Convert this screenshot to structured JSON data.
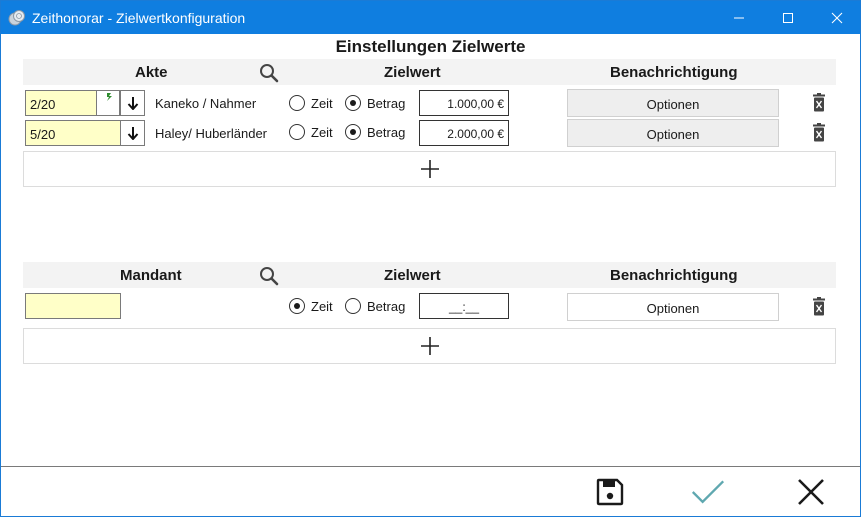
{
  "window": {
    "title": "Zeithonorar - Zielwertkonfiguration",
    "icon": "coins-icon",
    "controls": [
      "minimize-icon",
      "maximize-icon",
      "close-icon"
    ]
  },
  "section_title": "Einstellungen Zielwerte",
  "akte": {
    "header": {
      "col1": "Akte",
      "col2": "Zielwert",
      "col3": "Benachrichtigung",
      "search_icon": "search-icon"
    },
    "rows": [
      {
        "akte": "2/20",
        "name": "Kaneko / Nahmer",
        "radio_zeit": "Zeit",
        "radio_betrag": "Betrag",
        "selected": "Betrag",
        "amount": "1.000,00 €",
        "options": "Optionen"
      },
      {
        "akte": "5/20",
        "name": "Haley/ Huberländer",
        "radio_zeit": "Zeit",
        "radio_betrag": "Betrag",
        "selected": "Betrag",
        "amount": "2.000,00 €",
        "options": "Optionen"
      }
    ],
    "add_icon": "plus-icon"
  },
  "mandant": {
    "header": {
      "col1": "Mandant",
      "col2": "Zielwert",
      "col3": "Benachrichtigung",
      "search_icon": "search-icon"
    },
    "rows": [
      {
        "mandant": "",
        "radio_zeit": "Zeit",
        "radio_betrag": "Betrag",
        "selected": "Zeit",
        "amount": "__:__",
        "options": "Optionen"
      }
    ],
    "add_icon": "plus-icon"
  },
  "footer": {
    "save_icon": "save-icon",
    "ok_icon": "check-icon",
    "cancel_icon": "close-icon"
  },
  "colors": {
    "titlebar": "#0f7ee0",
    "field_yellow": "#ffffc8",
    "check_accent": "#5fa8b0"
  }
}
